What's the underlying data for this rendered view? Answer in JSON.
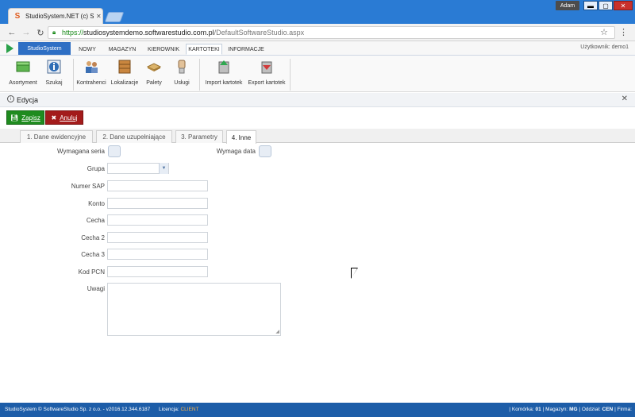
{
  "browser": {
    "tab_title": "StudioSystem.NET (c) So",
    "user": "Adam",
    "url_secure": "https://",
    "url_host": "studiosystemdemo.softwarestudio.com.pl",
    "url_path": "/DefaultSoftwareStudio.aspx"
  },
  "appnav": {
    "brand": "StudioSystem",
    "menu": [
      "NOWY",
      "MAGAZYN",
      "KIEROWNIK",
      "KARTOTEKI",
      "INFORMACJE"
    ],
    "active_menu": "KARTOTEKI",
    "user_label": "Użytkownik: demo1"
  },
  "ribbon": {
    "items": [
      "Asortyment",
      "Szukaj",
      "Kontrahenci",
      "Lokalizacje",
      "Palety",
      "Usługi",
      "Import kartotek",
      "Export kartotek"
    ]
  },
  "edit": {
    "title": "Edycja",
    "save": "Zapisz",
    "cancel": "Anuluj"
  },
  "tabs": [
    "1. Dane ewidencyjne",
    "2. Dane uzupełniające",
    "3. Parametry",
    "4. Inne"
  ],
  "form": {
    "wymagana_seria": "Wymagana seria",
    "wymaga_data": "Wymaga data",
    "grupa": "Grupa",
    "numer_sap": "Numer SAP",
    "konto": "Konto",
    "cecha": "Cecha",
    "cecha2": "Cecha 2",
    "cecha3": "Cecha 3",
    "kod_pcn": "Kod PCN",
    "uwagi": "Uwagi"
  },
  "footer": {
    "left": "StudioSystem © SoftwareStudio Sp. z o.o. - v2016.12.344.6187",
    "license_label": "Licencja:",
    "license_value": "CLIENT",
    "komorka_label": "Komórka:",
    "komorka": "01",
    "magazyn_label": "Magazyn:",
    "magazyn": "MG",
    "oddzial_label": "Oddział:",
    "oddzial": "CEN",
    "firma_label": "Firma:"
  },
  "colors": {
    "titlebar": "#2a7bd4",
    "brand": "#2e6fc4",
    "save": "#1f8b1f",
    "cancel": "#a31b1b",
    "footer": "#1d5da8"
  }
}
